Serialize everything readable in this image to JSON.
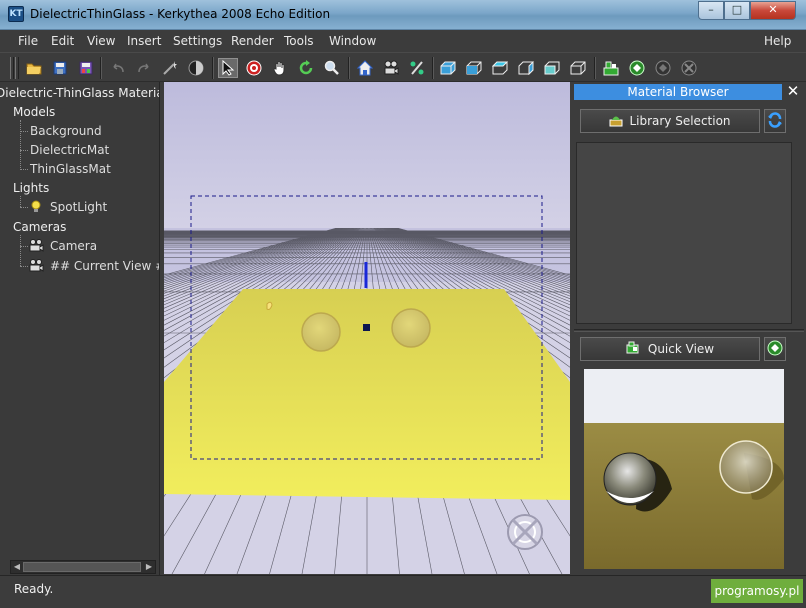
{
  "window": {
    "title": "DielectricThinGlass - Kerkythea 2008 Echo Edition",
    "app_icon_text": "KT",
    "minimize_glyph": "–",
    "maximize_glyph": "□",
    "close_glyph": "✕"
  },
  "menu": {
    "items": [
      "File",
      "Edit",
      "View",
      "Insert",
      "Settings",
      "Render",
      "Tools",
      "Window"
    ],
    "help": "Help"
  },
  "toolbar": {
    "icons": [
      "open-folder-icon",
      "save-icon",
      "save-as-icon",
      "undo-icon",
      "redo-icon",
      "magic-wand-icon",
      "sphere-icon",
      "select-arrow-icon",
      "target-icon",
      "hand-pan-icon",
      "rotate-icon",
      "zoom-icon",
      "home-icon",
      "camera-icon",
      "percent-icon",
      "box-view-1-icon",
      "box-view-2-icon",
      "box-view-3-icon",
      "box-view-4-icon",
      "box-view-5-icon",
      "box-view-6-icon",
      "render-scene-icon",
      "render-start-icon",
      "render-pause-icon",
      "render-stop-icon"
    ]
  },
  "tree": {
    "root": "Dielectric-ThinGlass Materials",
    "models_label": "Models",
    "models": [
      "Background",
      "DielectricMat",
      "ThinGlassMat"
    ],
    "lights_label": "Lights",
    "lights": [
      "SpotLight"
    ],
    "cameras_label": "Cameras",
    "cameras": [
      "Camera",
      "## Current View ##"
    ]
  },
  "material_browser": {
    "title": "Material Browser",
    "close": "✕",
    "library_button": "Library Selection",
    "quick_view_button": "Quick View"
  },
  "colors": {
    "sky_top": "#c9c6e0",
    "floor_yellow": "#e8e456",
    "selection_box": "#1a1a8a",
    "accent": "#3d8ee0",
    "watermark_green": "#6fae3d"
  },
  "status": {
    "text": "Ready.",
    "watermark": "programosy.pl"
  }
}
